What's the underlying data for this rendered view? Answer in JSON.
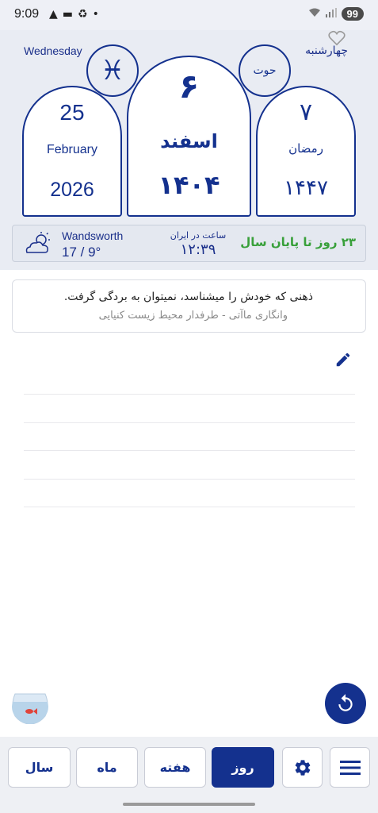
{
  "status_bar": {
    "time": "9:09",
    "battery": "99"
  },
  "header": {
    "weekday_en": "Wednesday",
    "weekday_fa": "چهارشنبه",
    "zodiac_symbol": "♓",
    "zodiac_fa": "حوت",
    "gregorian": {
      "day": "25",
      "month": "February",
      "year": "2026"
    },
    "solar": {
      "day": "۶",
      "month": "اسفند",
      "year": "۱۴۰۴"
    },
    "lunar": {
      "day": "۷",
      "month": "رمضان",
      "year": "۱۴۴۷"
    }
  },
  "info_strip": {
    "city": "Wandsworth",
    "temperature": "17 / 9°",
    "iran_time_label": "ساعت در ایران",
    "iran_time": "۱۲:۳۹",
    "days_left": "۲۳ روز تا پایان سال"
  },
  "quote": {
    "text": "ذهنی که خودش را میشناسد، نمیتوان به بردگی گرفت.",
    "author": "وانگاری ماآتی - طرفدار محیط زیست کنیایی"
  },
  "nav": {
    "year": "سال",
    "month": "ماه",
    "week": "هفته",
    "day": "روز"
  },
  "colors": {
    "primary": "#14318e",
    "accent_green": "#38a03a"
  }
}
